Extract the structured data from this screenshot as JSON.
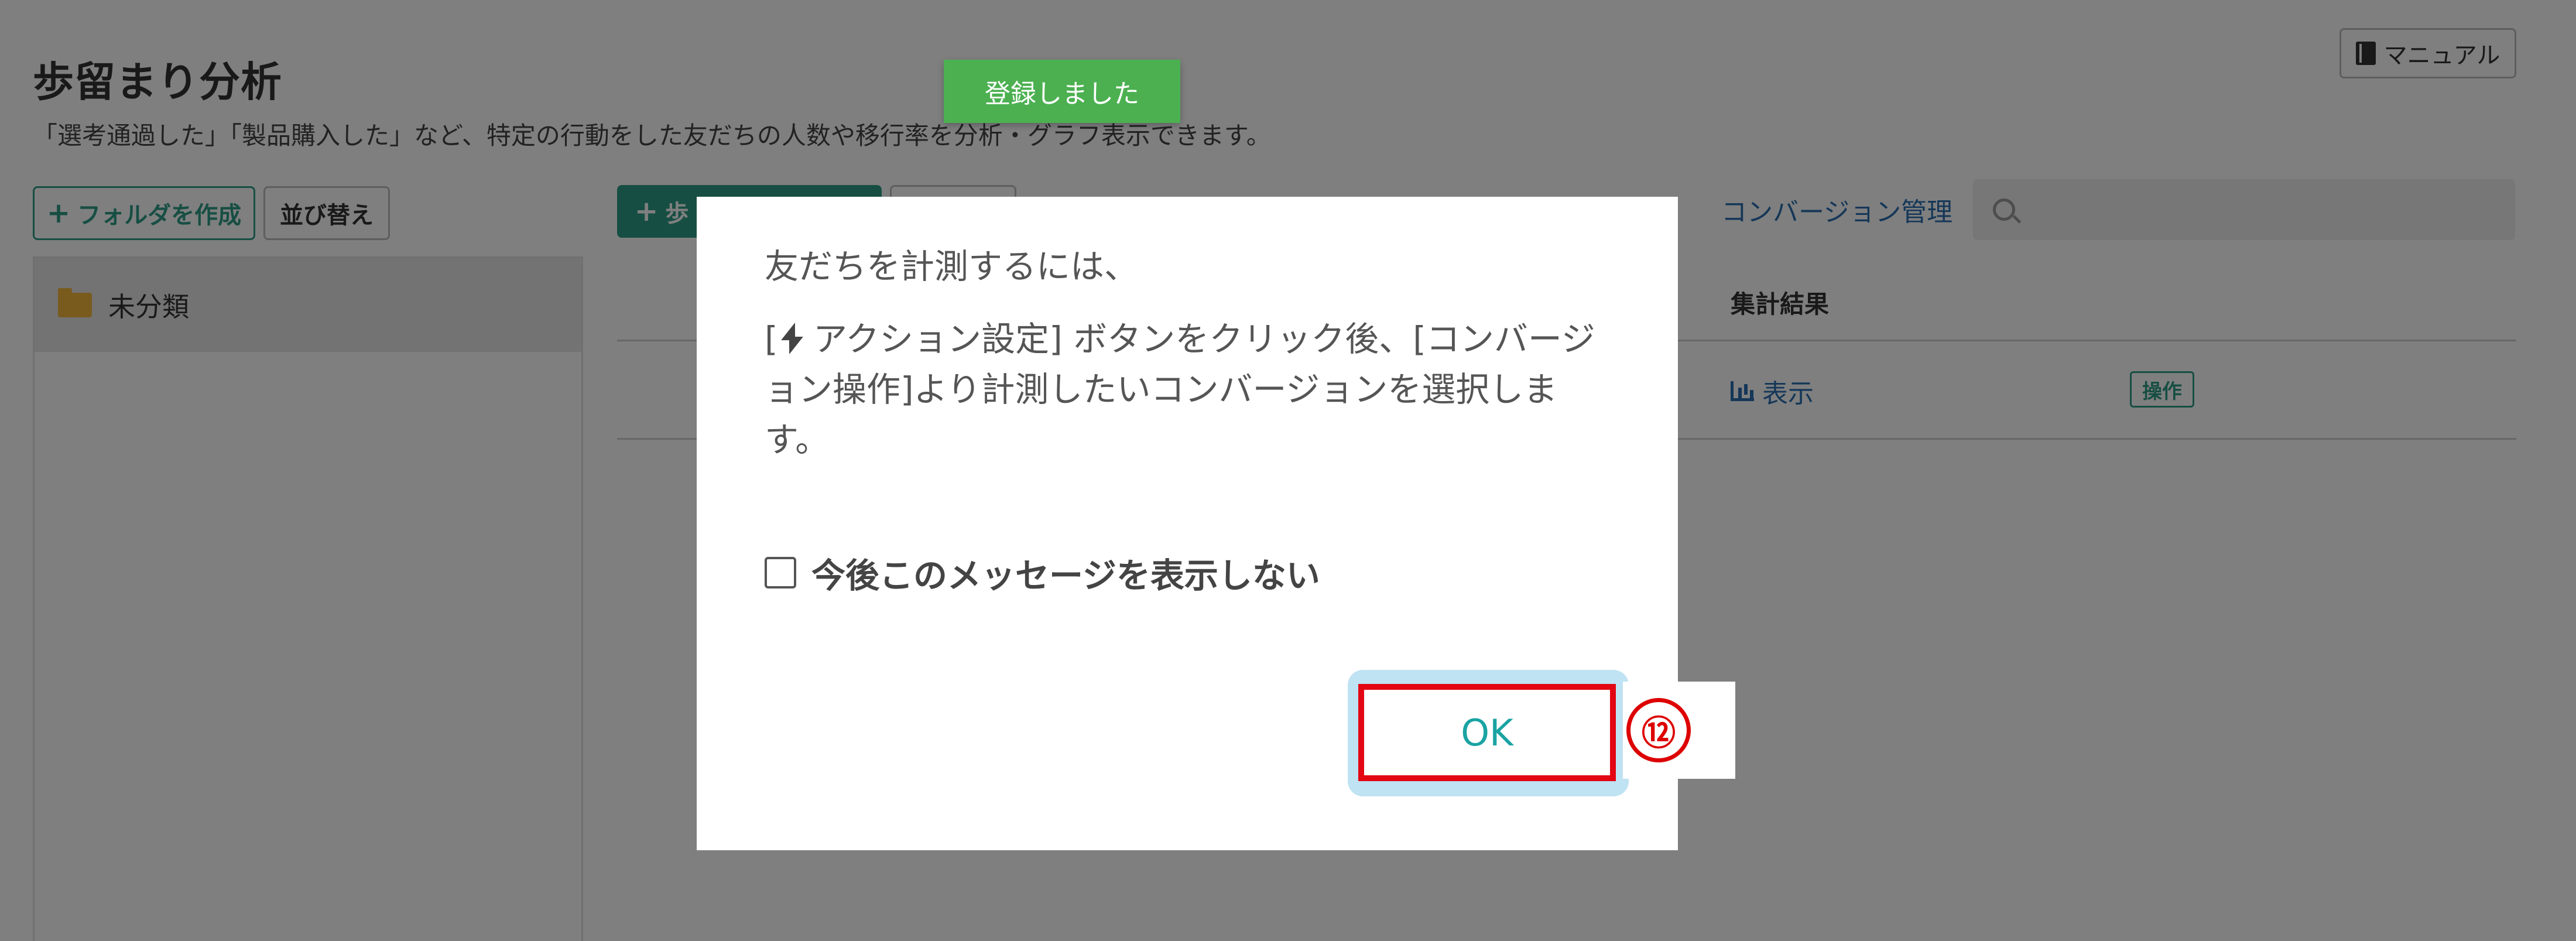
{
  "header": {
    "title": "歩留まり分析",
    "description": "「選考通過した」「製品購入した」など、特定の行動をした友だちの人数や移行率を分析・グラフ表示できます。",
    "manual_label": "マニュアル"
  },
  "sidebar": {
    "create_folder_label": "フォルダを作成",
    "sort_label": "並び替え",
    "folders": [
      {
        "label": "未分類"
      }
    ]
  },
  "main": {
    "create_button_label": "歩",
    "conversion_link": "コンバージョン管理",
    "table": {
      "result_header": "集計結果",
      "rows": [
        {
          "result_link": "表示",
          "op_badge": "操作"
        }
      ]
    }
  },
  "toast": {
    "message": "登録しました"
  },
  "modal": {
    "line1": "友だちを計測するには、",
    "line2_pre": "[",
    "line2_post": " アクション設定] ボタンをクリック後、[コンバージョン操作]より計測したいコンバージョンを選択します。",
    "checkbox_label": "今後このメッセージを表示しない",
    "ok_label": "OK"
  },
  "annotation": {
    "step_number": "⑫"
  },
  "colors": {
    "primary": "#2e9c86",
    "link": "#2a6fb0",
    "toast": "#4cb051",
    "highlight_border": "#e30613",
    "focus_ring": "#bfe3f3",
    "ok_text": "#1aa3a3"
  },
  "icons": {
    "manual": "book-icon",
    "folder": "folder-open-icon",
    "search": "search-icon",
    "chart": "bar-chart-icon",
    "bolt": "bolt-icon"
  }
}
